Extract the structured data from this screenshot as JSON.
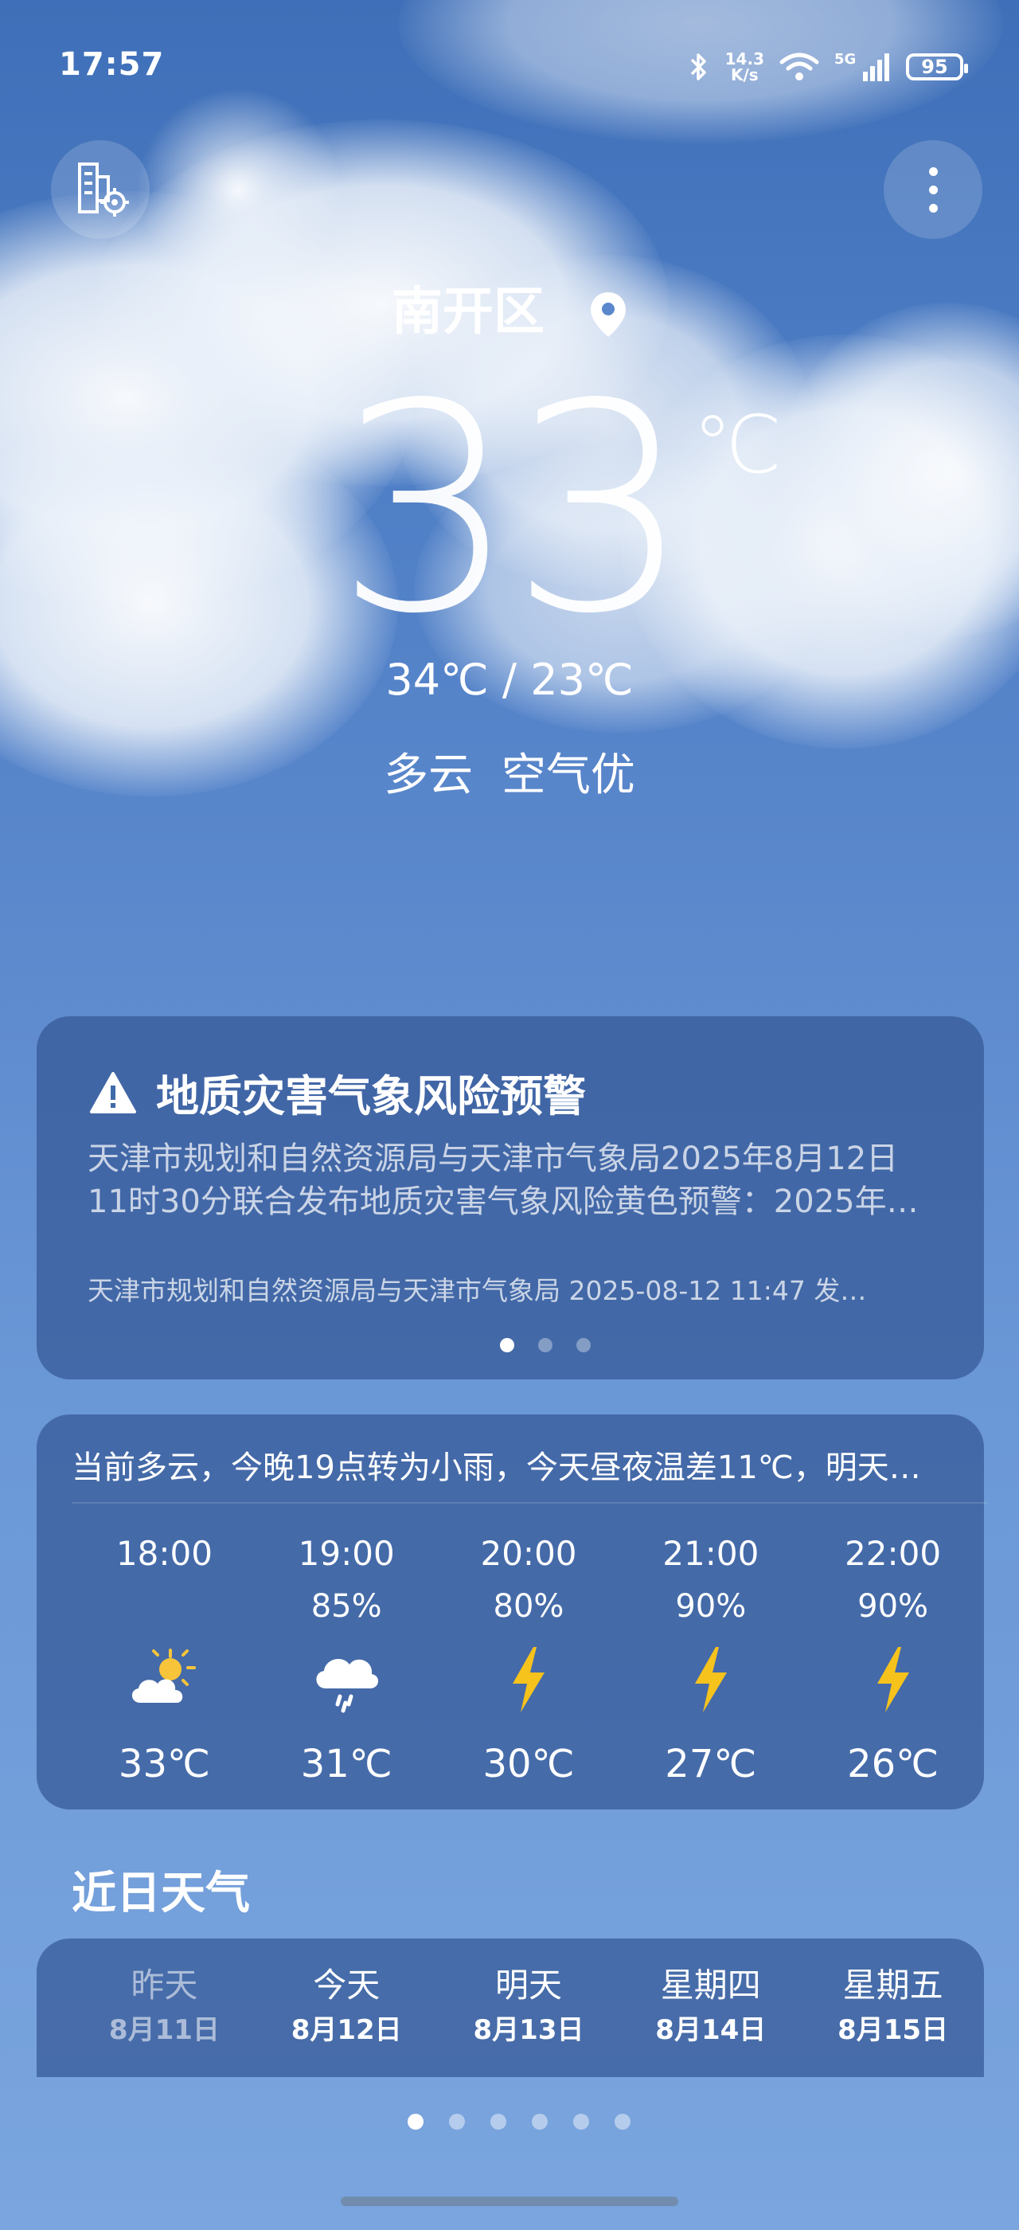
{
  "status_bar": {
    "time": "17:57",
    "net_speed_value": "14.3",
    "net_speed_unit": "K/s",
    "signal_label": "5G",
    "battery": "95"
  },
  "header": {
    "city_icon": "city-settings-icon",
    "more_icon": "more-vertical-icon"
  },
  "current": {
    "location": "南开区",
    "temperature": "33",
    "unit": "℃",
    "range": "34℃ / 23℃",
    "condition": "多云",
    "air_quality": "空气优"
  },
  "alert": {
    "title": "地质灾害气象风险预警",
    "line1": "天津市规划和自然资源局与天津市气象局2025年8月12日",
    "line2": "11时30分联合发布地质灾害气象风险黄色预警：2025年…",
    "source": "天津市规划和自然资源局与天津市气象局 2025-08-12 11:47 发…",
    "pages": 3,
    "active_page": 1
  },
  "hourly": {
    "summary": "当前多云，今晚19点转为小雨，今天昼夜温差11℃，明天…",
    "items": [
      {
        "time": "18:00",
        "precip": "",
        "icon": "partly-cloudy-sun-icon",
        "temp": "33℃"
      },
      {
        "time": "19:00",
        "precip": "85%",
        "icon": "light-rain-icon",
        "temp": "31℃"
      },
      {
        "time": "20:00",
        "precip": "80%",
        "icon": "thunder-icon",
        "temp": "30℃"
      },
      {
        "time": "21:00",
        "precip": "90%",
        "icon": "thunder-icon",
        "temp": "27℃"
      },
      {
        "time": "22:00",
        "precip": "90%",
        "icon": "thunder-icon",
        "temp": "26℃"
      }
    ]
  },
  "daily": {
    "title": "近日天气",
    "items": [
      {
        "name": "昨天",
        "date": "8月11日"
      },
      {
        "name": "今天",
        "date": "8月12日"
      },
      {
        "name": "明天",
        "date": "8月13日"
      },
      {
        "name": "星期四",
        "date": "8月14日"
      },
      {
        "name": "星期五",
        "date": "8月15日"
      }
    ]
  },
  "pager": {
    "count": 6,
    "active": 1
  },
  "colors": {
    "thunder": "#f6c21c",
    "sun": "#f7c43a",
    "card": "#345896"
  }
}
